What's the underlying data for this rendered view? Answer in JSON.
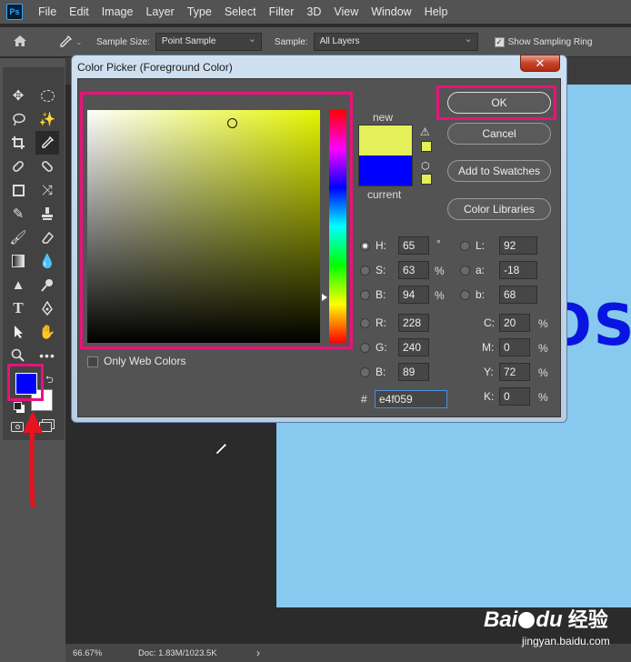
{
  "app": {
    "logo": "Ps"
  },
  "menubar": [
    "File",
    "Edit",
    "Image",
    "Layer",
    "Type",
    "Select",
    "Filter",
    "3D",
    "View",
    "Window",
    "Help"
  ],
  "options": {
    "sample_size_label": "Sample Size:",
    "sample_size_value": "Point Sample",
    "sample_label": "Sample:",
    "sample_value": "All Layers",
    "show_ring_label": "Show Sampling Ring",
    "collapse": "«"
  },
  "dialog": {
    "title": "Color Picker (Foreground Color)",
    "close": "✕",
    "ok": "OK",
    "cancel": "Cancel",
    "add_swatches": "Add to Swatches",
    "color_libraries": "Color Libraries",
    "new_label": "new",
    "current_label": "current",
    "only_web": "Only Web Colors",
    "new_color": "#e4f059",
    "current_color": "#0000ff",
    "hsb": {
      "h_label": "H:",
      "h": "65",
      "h_unit": "°",
      "s_label": "S:",
      "s": "63",
      "s_unit": "%",
      "b_label": "B:",
      "b": "94",
      "b_unit": "%"
    },
    "rgb": {
      "r_label": "R:",
      "r": "228",
      "g_label": "G:",
      "g": "240",
      "b_label": "B:",
      "b": "89"
    },
    "lab": {
      "l_label": "L:",
      "l": "92",
      "a_label": "a:",
      "a": "-18",
      "b_label": "b:",
      "b": "68"
    },
    "cmyk": {
      "c_label": "C:",
      "c": "20",
      "m_label": "M:",
      "m": "0",
      "y_label": "Y:",
      "y": "72",
      "k_label": "K:",
      "k": "0",
      "unit": "%"
    },
    "hex_label": "#",
    "hex": "e4f059"
  },
  "canvas": {
    "text": "OSU",
    "text_color": "#0a14e0"
  },
  "status": {
    "zoom": "66.67%",
    "doc": "Doc: 1.83M/1023.5K",
    "arrow": "›"
  },
  "watermark": {
    "brand": "Bai",
    "brand2": "du",
    "cn": "经验",
    "url": "jingyan.baidu.com"
  },
  "foreground_color": "#0000ff",
  "background_color": "#ffffff",
  "highlight_color": "#e8137a"
}
